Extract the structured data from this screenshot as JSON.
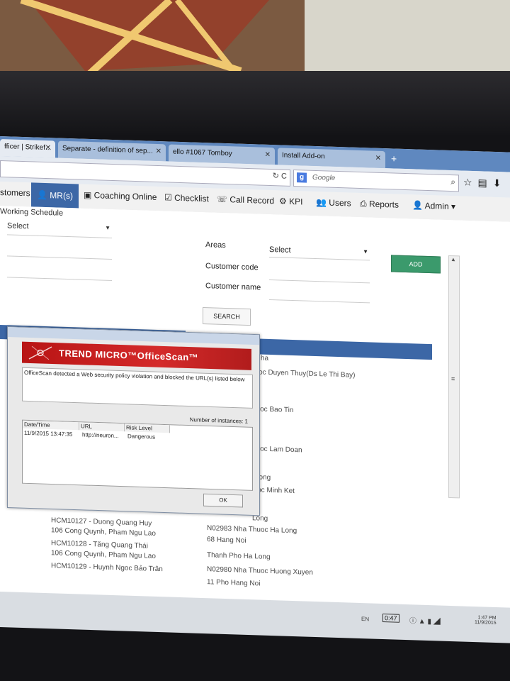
{
  "browser": {
    "tabs": [
      {
        "label": "fficer | Strikef...",
        "close": "✕"
      },
      {
        "label": "Separate - definition of sep...",
        "close": "✕"
      },
      {
        "label": "ello #1067 Tomboy",
        "close": "✕"
      },
      {
        "label": "Install Add-on",
        "close": "✕"
      }
    ],
    "new_tab": "+",
    "reload_icon": "↻ C",
    "search_placeholder": "Google"
  },
  "menu": {
    "items": [
      "stomers",
      "MR(s)",
      "Coaching Online",
      "Checklist",
      "Call Record",
      "KPI",
      "Users",
      "Reports",
      "Admin"
    ]
  },
  "page": {
    "section_title": "Working Schedule",
    "left_select": "Select",
    "form": {
      "areas_label": "Areas",
      "areas_value": "Select",
      "customer_code_label": "Customer code",
      "customer_name_label": "Customer name",
      "add_button": "ADD",
      "search_button": "SEARCH"
    },
    "left_list": [
      "HCM10127 - Duong Quang Huy",
      "106 Cong Quynh, Pham Ngu Lao",
      "HCM10128 - Tăng Quang Thái",
      "106 Cong Quynh, Pham Ngu Lao",
      "HCM10129 - Huynh Ngoc Bảo Trân"
    ],
    "right_list": [
      "ha",
      "huoc Duyen Thuy(Ds Le Thi Bay)",
      "huoc Bao Tin",
      "ha",
      "huoc Lam Doan",
      "Long",
      "huoc Minh Ket",
      "Long",
      "N02983 Nha Thuoc Ha Long",
      "68 Hang Noi",
      "Thanh Pho Ha Long",
      "N02980 Nha Thuoc Huong Xuyen",
      "11 Pho Hang Noi"
    ]
  },
  "dialog": {
    "title": "TREND MICRO™OfficeScan™",
    "message": "OfficeScan detected a Web security policy violation and blocked the URL(s) listed below",
    "instances": "Number of instances: 1",
    "columns": [
      "Date/Time",
      "URL",
      "Risk Level"
    ],
    "row": [
      "11/9/2015 13:47:35",
      "http://neuron...",
      "Dangerous"
    ],
    "ok": "OK"
  },
  "taskbar": {
    "lang": "EN",
    "battery": "0:47",
    "time": "1:47 PM",
    "date": "11/9/2015"
  },
  "colors": {
    "accent": "#3c67a6",
    "add_green": "#3b9a6c",
    "trend_red": "#c41f1f"
  }
}
